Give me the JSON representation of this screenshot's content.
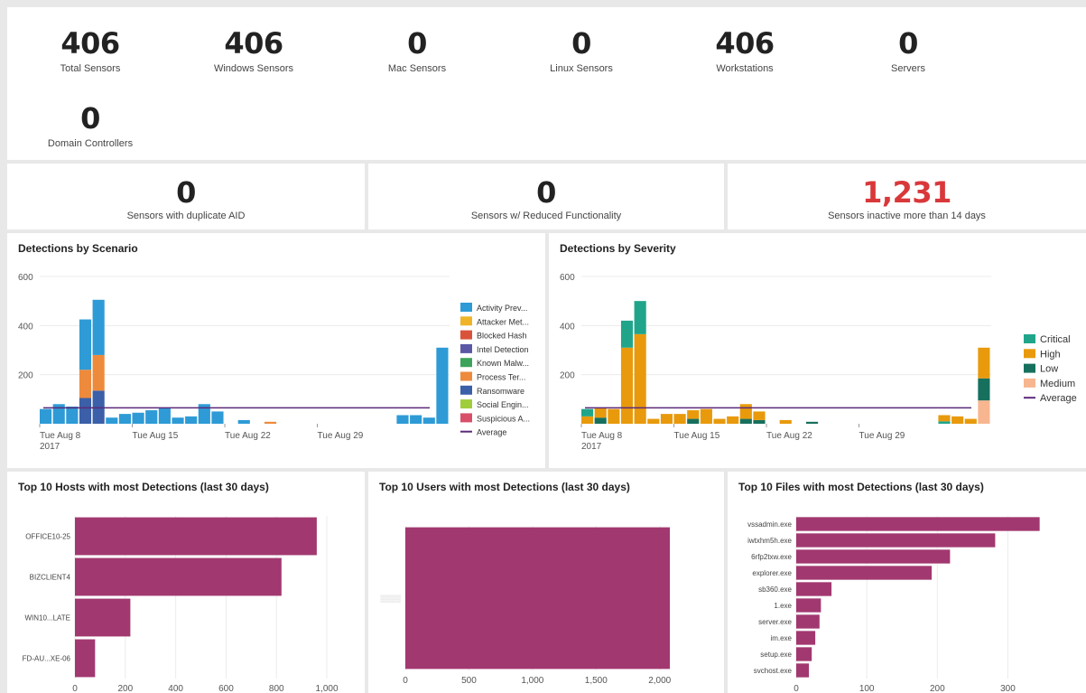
{
  "top_stats": [
    {
      "value": "406",
      "label": "Total Sensors"
    },
    {
      "value": "406",
      "label": "Windows Sensors"
    },
    {
      "value": "0",
      "label": "Mac Sensors"
    },
    {
      "value": "0",
      "label": "Linux Sensors"
    },
    {
      "value": "406",
      "label": "Workstations"
    },
    {
      "value": "0",
      "label": "Servers"
    },
    {
      "value": "0",
      "label": "Domain Controllers"
    }
  ],
  "mid_stats": [
    {
      "value": "0",
      "label": "Sensors with duplicate AID",
      "color": "#222222"
    },
    {
      "value": "0",
      "label": "Sensors w/ Reduced Functionality",
      "color": "#222222"
    },
    {
      "value": "1,231",
      "label": "Sensors inactive more than 14 days",
      "color": "#d9383a"
    }
  ],
  "chart_data": [
    {
      "type": "bar",
      "stacked": true,
      "title": "Detections by Scenario",
      "x_ticks": [
        "Tue Aug 8",
        "Tue Aug 15",
        "Tue Aug 22",
        "Tue Aug 29"
      ],
      "x_tick_sub": "2017",
      "y_ticks": [
        "200",
        "400",
        "600"
      ],
      "ylim": [
        0,
        600
      ],
      "average": 65,
      "legend": [
        {
          "name": "Activity Prev...",
          "color": "#2e9bd6"
        },
        {
          "name": "Attacker Met...",
          "color": "#f0b428"
        },
        {
          "name": "Blocked Hash",
          "color": "#d9533a"
        },
        {
          "name": "Intel Detection",
          "color": "#5b57a6"
        },
        {
          "name": "Known Malw...",
          "color": "#3da35a"
        },
        {
          "name": "Process Ter...",
          "color": "#ee8a3c"
        },
        {
          "name": "Ransomware",
          "color": "#3b5fa8"
        },
        {
          "name": "Social Engin...",
          "color": "#9fcd3c"
        },
        {
          "name": "Suspicious A...",
          "color": "#d94f6a"
        },
        {
          "name": "Average",
          "color": "#5b2a7a",
          "line": true
        }
      ],
      "bars": [
        {
          "day": 0,
          "stack": [
            {
              "s": 0,
              "v": 60
            }
          ]
        },
        {
          "day": 1,
          "stack": [
            {
              "s": 0,
              "v": 80
            }
          ]
        },
        {
          "day": 2,
          "stack": [
            {
              "s": 0,
              "v": 70
            }
          ]
        },
        {
          "day": 3,
          "stack": [
            {
              "s": 6,
              "v": 105
            },
            {
              "s": 5,
              "v": 115
            },
            {
              "s": 0,
              "v": 205
            }
          ]
        },
        {
          "day": 4,
          "stack": [
            {
              "s": 6,
              "v": 135
            },
            {
              "s": 5,
              "v": 145
            },
            {
              "s": 0,
              "v": 225
            }
          ]
        },
        {
          "day": 5,
          "stack": [
            {
              "s": 0,
              "v": 25
            }
          ]
        },
        {
          "day": 6,
          "stack": [
            {
              "s": 0,
              "v": 40
            }
          ]
        },
        {
          "day": 7,
          "stack": [
            {
              "s": 0,
              "v": 45
            }
          ]
        },
        {
          "day": 8,
          "stack": [
            {
              "s": 0,
              "v": 55
            }
          ]
        },
        {
          "day": 9,
          "stack": [
            {
              "s": 0,
              "v": 65
            }
          ]
        },
        {
          "day": 10,
          "stack": [
            {
              "s": 0,
              "v": 25
            }
          ]
        },
        {
          "day": 11,
          "stack": [
            {
              "s": 0,
              "v": 30
            }
          ]
        },
        {
          "day": 12,
          "stack": [
            {
              "s": 0,
              "v": 80
            }
          ]
        },
        {
          "day": 13,
          "stack": [
            {
              "s": 0,
              "v": 50
            }
          ]
        },
        {
          "day": 15,
          "stack": [
            {
              "s": 0,
              "v": 15
            }
          ]
        },
        {
          "day": 17,
          "stack": [
            {
              "s": 5,
              "v": 8
            }
          ]
        },
        {
          "day": 27,
          "stack": [
            {
              "s": 0,
              "v": 35
            }
          ]
        },
        {
          "day": 28,
          "stack": [
            {
              "s": 0,
              "v": 35
            }
          ]
        },
        {
          "day": 29,
          "stack": [
            {
              "s": 0,
              "v": 25
            }
          ]
        },
        {
          "day": 30,
          "stack": [
            {
              "s": 0,
              "v": 310
            }
          ]
        }
      ]
    },
    {
      "type": "bar",
      "stacked": true,
      "title": "Detections by Severity",
      "x_ticks": [
        "Tue Aug 8",
        "Tue Aug 15",
        "Tue Aug 22",
        "Tue Aug 29"
      ],
      "x_tick_sub": "2017",
      "y_ticks": [
        "200",
        "400",
        "600"
      ],
      "ylim": [
        0,
        600
      ],
      "average": 65,
      "legend": [
        {
          "name": "Critical",
          "color": "#20a58a"
        },
        {
          "name": "High",
          "color": "#e89a0c"
        },
        {
          "name": "Low",
          "color": "#17705d"
        },
        {
          "name": "Medium",
          "color": "#f7b690"
        },
        {
          "name": "Average",
          "color": "#5b2a7a",
          "line": true
        }
      ],
      "bars": [
        {
          "day": 0,
          "stack": [
            {
              "s": 1,
              "v": 30
            },
            {
              "s": 0,
              "v": 30
            }
          ]
        },
        {
          "day": 1,
          "stack": [
            {
              "s": 2,
              "v": 25
            },
            {
              "s": 1,
              "v": 40
            }
          ]
        },
        {
          "day": 2,
          "stack": [
            {
              "s": 1,
              "v": 60
            }
          ]
        },
        {
          "day": 3,
          "stack": [
            {
              "s": 1,
              "v": 310
            },
            {
              "s": 0,
              "v": 110
            }
          ]
        },
        {
          "day": 4,
          "stack": [
            {
              "s": 1,
              "v": 365
            },
            {
              "s": 0,
              "v": 135
            }
          ]
        },
        {
          "day": 5,
          "stack": [
            {
              "s": 1,
              "v": 20
            }
          ]
        },
        {
          "day": 6,
          "stack": [
            {
              "s": 1,
              "v": 40
            }
          ]
        },
        {
          "day": 7,
          "stack": [
            {
              "s": 1,
              "v": 40
            }
          ]
        },
        {
          "day": 8,
          "stack": [
            {
              "s": 2,
              "v": 20
            },
            {
              "s": 1,
              "v": 35
            }
          ]
        },
        {
          "day": 9,
          "stack": [
            {
              "s": 1,
              "v": 60
            }
          ]
        },
        {
          "day": 10,
          "stack": [
            {
              "s": 1,
              "v": 20
            }
          ]
        },
        {
          "day": 11,
          "stack": [
            {
              "s": 1,
              "v": 30
            }
          ]
        },
        {
          "day": 12,
          "stack": [
            {
              "s": 2,
              "v": 20
            },
            {
              "s": 1,
              "v": 60
            }
          ]
        },
        {
          "day": 13,
          "stack": [
            {
              "s": 2,
              "v": 15
            },
            {
              "s": 1,
              "v": 35
            }
          ]
        },
        {
          "day": 15,
          "stack": [
            {
              "s": 1,
              "v": 15
            }
          ]
        },
        {
          "day": 17,
          "stack": [
            {
              "s": 2,
              "v": 8
            }
          ]
        },
        {
          "day": 27,
          "stack": [
            {
              "s": 0,
              "v": 10
            },
            {
              "s": 1,
              "v": 25
            }
          ]
        },
        {
          "day": 28,
          "stack": [
            {
              "s": 1,
              "v": 30
            }
          ]
        },
        {
          "day": 29,
          "stack": [
            {
              "s": 1,
              "v": 20
            }
          ]
        },
        {
          "day": 30,
          "stack": [
            {
              "s": 3,
              "v": 95
            },
            {
              "s": 2,
              "v": 90
            },
            {
              "s": 1,
              "v": 125
            }
          ]
        }
      ]
    },
    {
      "type": "bar",
      "orientation": "horizontal",
      "title": "Top 10 Hosts with most Detections (last 30 days)",
      "categories": [
        "OFFICE10-25",
        "BIZCLIENT4",
        "WIN10...LATE",
        "FD-AU...XE-06"
      ],
      "values": [
        960,
        820,
        220,
        80
      ],
      "xlim": [
        0,
        1050
      ],
      "x_ticks": [
        0,
        200,
        400,
        600,
        800,
        1000
      ],
      "x_tick_labels": [
        "0",
        "200",
        "400",
        "600",
        "800",
        "1,000"
      ],
      "color": "#a23870"
    },
    {
      "type": "bar",
      "orientation": "horizontal",
      "title": "Top 10 Users with most Detections (last 30 days)",
      "categories": [
        "▒▒▒▒"
      ],
      "values": [
        2080
      ],
      "xlim": [
        0,
        2300
      ],
      "x_ticks": [
        0,
        500,
        1000,
        1500,
        2000
      ],
      "x_tick_labels": [
        "0",
        "500",
        "1,000",
        "1,500",
        "2,000"
      ],
      "color": "#a23870"
    },
    {
      "type": "bar",
      "orientation": "horizontal",
      "title": "Top 10 Files with most Detections (last 30 days)",
      "categories": [
        "vssadmin.exe",
        "iwtxhm5h.exe",
        "6rfp2txw.exe",
        "explorer.exe",
        "sb360.exe",
        "1.exe",
        "server.exe",
        "im.exe",
        "setup.exe",
        "svchost.exe"
      ],
      "values": [
        345,
        282,
        218,
        192,
        50,
        35,
        33,
        27,
        22,
        18
      ],
      "xlim": [
        0,
        380
      ],
      "x_ticks": [
        0,
        100,
        200,
        300
      ],
      "x_tick_labels": [
        "0",
        "100",
        "200",
        "300"
      ],
      "color": "#a23870"
    }
  ]
}
